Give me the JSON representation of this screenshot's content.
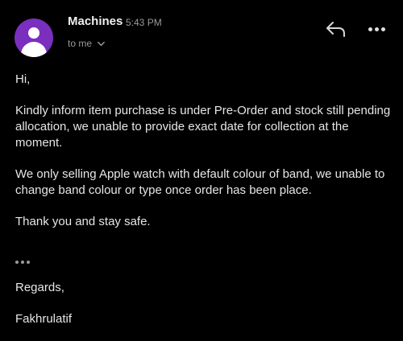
{
  "header": {
    "sender_name": "Machines",
    "time": "5:43 PM",
    "recipient_label": "to me",
    "avatar_color": "#7b2fbe",
    "reply_icon": "reply-icon",
    "more_icon": "more-horizontal-icon"
  },
  "message": {
    "greeting": "Hi,",
    "paragraph1": "Kindly inform item purchase is under Pre-Order and stock still pending allocation, we unable to provide exact date for collection at the moment.",
    "paragraph2": "We only selling Apple watch with default colour of band, we unable to change band colour or type once order has been place.",
    "paragraph3": "Thank you and stay safe.",
    "trimmed_icon": "ellipsis-icon",
    "closing": "Regards,",
    "signature": "Fakhrulatif"
  }
}
